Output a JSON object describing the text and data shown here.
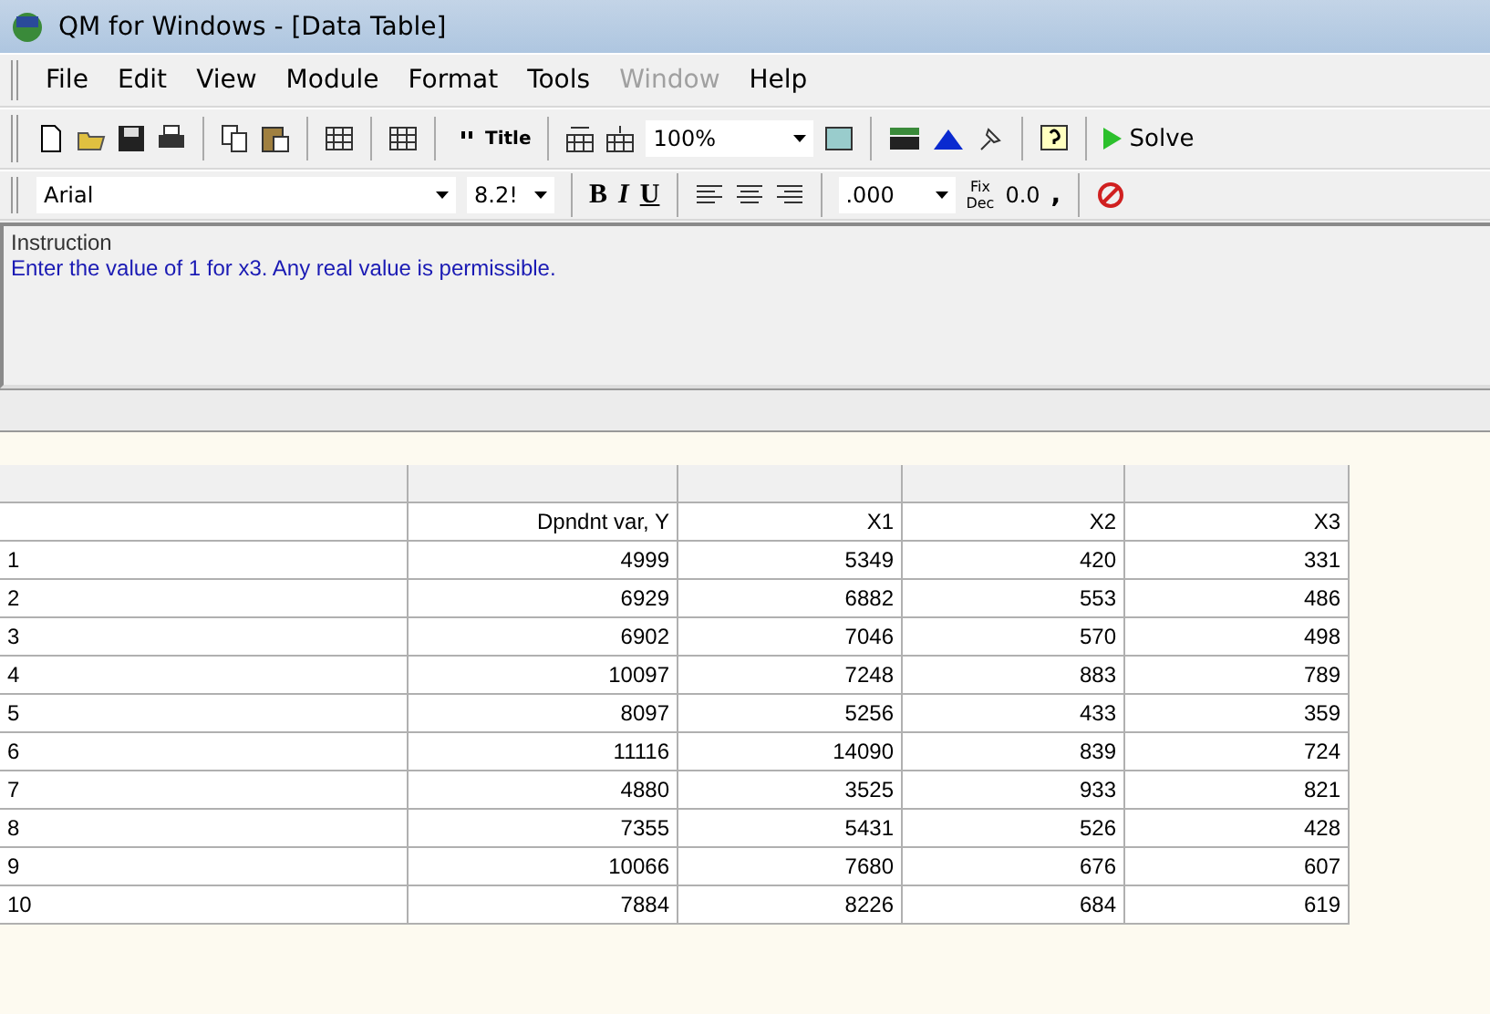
{
  "window": {
    "title": "QM for Windows - [Data Table]"
  },
  "menu": [
    {
      "label": "File",
      "disabled": false
    },
    {
      "label": "Edit",
      "disabled": false
    },
    {
      "label": "View",
      "disabled": false
    },
    {
      "label": "Module",
      "disabled": false
    },
    {
      "label": "Format",
      "disabled": false
    },
    {
      "label": "Tools",
      "disabled": false
    },
    {
      "label": "Window",
      "disabled": true
    },
    {
      "label": "Help",
      "disabled": false
    }
  ],
  "toolbar": {
    "title_button": "Title",
    "zoom": "100%",
    "solve": "Solve"
  },
  "format_bar": {
    "font": "Arial",
    "size": "8.2!",
    "bold": "B",
    "italic": "I",
    "underline": "U",
    "decimals": ".000",
    "fix": "Fix",
    "dec": "Dec",
    "precision": "0.0",
    "comma": ","
  },
  "instruction": {
    "label": "Instruction",
    "text": "Enter the value of  1 for x3. Any real value is permissible."
  },
  "table": {
    "columns": [
      "",
      "Dpndnt var, Y",
      "X1",
      "X2",
      "X3"
    ],
    "rows": [
      [
        "1",
        "4999",
        "5349",
        "420",
        "331"
      ],
      [
        "2",
        "6929",
        "6882",
        "553",
        "486"
      ],
      [
        "3",
        "6902",
        "7046",
        "570",
        "498"
      ],
      [
        "4",
        "10097",
        "7248",
        "883",
        "789"
      ],
      [
        "5",
        "8097",
        "5256",
        "433",
        "359"
      ],
      [
        "6",
        "11116",
        "14090",
        "839",
        "724"
      ],
      [
        "7",
        "4880",
        "3525",
        "933",
        "821"
      ],
      [
        "8",
        "7355",
        "5431",
        "526",
        "428"
      ],
      [
        "9",
        "10066",
        "7680",
        "676",
        "607"
      ],
      [
        "10",
        "7884",
        "8226",
        "684",
        "619"
      ]
    ]
  }
}
